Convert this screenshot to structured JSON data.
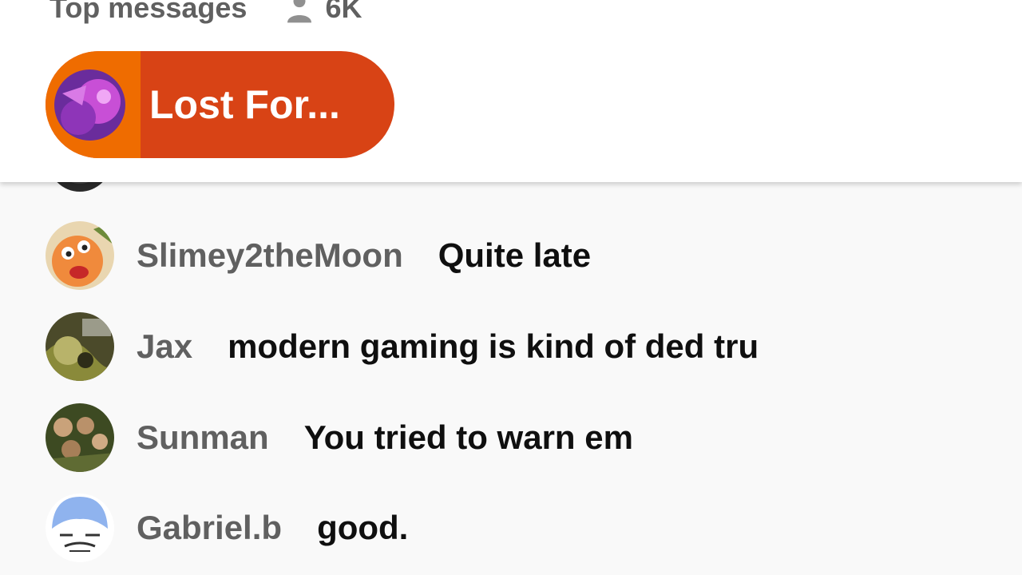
{
  "header": {
    "title": "Top messages",
    "viewer_count": "6K",
    "icons": [
      "person-icon"
    ]
  },
  "pinned": {
    "name": "Lost For...",
    "colors": {
      "pill": "#d84315",
      "progress": "#ef6c00"
    }
  },
  "messages": [
    {
      "author": "Slimey2theMoon",
      "text": "Quite late"
    },
    {
      "author": "Jax",
      "text": "modern gaming is kind of ded tru"
    },
    {
      "author": "Sunman",
      "text": "You tried to warn em"
    },
    {
      "author": "Gabriel.b",
      "text": "good."
    }
  ],
  "colors": {
    "background": "#f9f9f9",
    "author": "#606060",
    "text": "#0f0f0f"
  }
}
